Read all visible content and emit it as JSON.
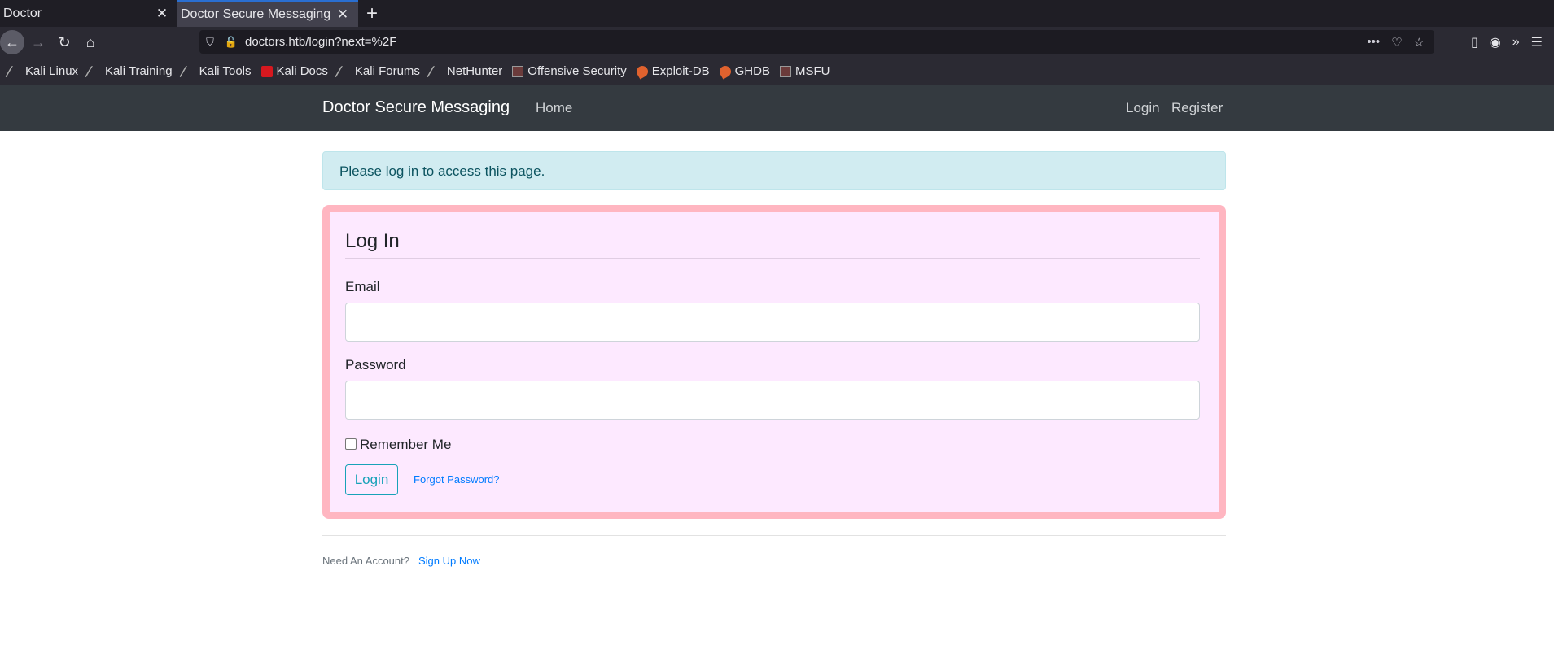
{
  "browser": {
    "tabs": [
      {
        "title": "Doctor",
        "active": false
      },
      {
        "title": "Doctor Secure Messaging - D",
        "active": true
      }
    ],
    "new_tab_icon": "+",
    "url": "doctors.htb/login?next=%2F",
    "bookmarks": [
      {
        "label": "Kali Linux",
        "icon": "kali-dragon-icon"
      },
      {
        "label": "Kali Training",
        "icon": "kali-dragon-icon"
      },
      {
        "label": "Kali Tools",
        "icon": "kali-dragon-icon"
      },
      {
        "label": "Kali Docs",
        "icon": "kali-docs-icon"
      },
      {
        "label": "Kali Forums",
        "icon": "kali-dragon-icon"
      },
      {
        "label": "NetHunter",
        "icon": "kali-dragon-icon"
      },
      {
        "label": "Offensive Security",
        "icon": "offsec-icon"
      },
      {
        "label": "Exploit-DB",
        "icon": "exploit-db-icon"
      },
      {
        "label": "GHDB",
        "icon": "exploit-db-icon"
      },
      {
        "label": "MSFU",
        "icon": "offsec-icon"
      }
    ]
  },
  "site": {
    "brand": "Doctor Secure Messaging",
    "nav_home": "Home",
    "nav_login": "Login",
    "nav_register": "Register"
  },
  "alert": "Please log in to access this page.",
  "form": {
    "legend": "Log In",
    "email_label": "Email",
    "email_value": "",
    "password_label": "Password",
    "password_value": "",
    "remember_label": "Remember Me",
    "remember_checked": false,
    "login_button": "Login",
    "forgot_link": "Forgot Password?"
  },
  "footer": {
    "text": "Need An Account?",
    "link": "Sign Up Now"
  },
  "colors": {
    "navbar": "#343a40",
    "alert_bg": "#d1ecf1",
    "card_border": "#ffb6c1",
    "card_bg": "#fde9ff",
    "button_outline": "#17a2b8",
    "link": "#007bff"
  }
}
